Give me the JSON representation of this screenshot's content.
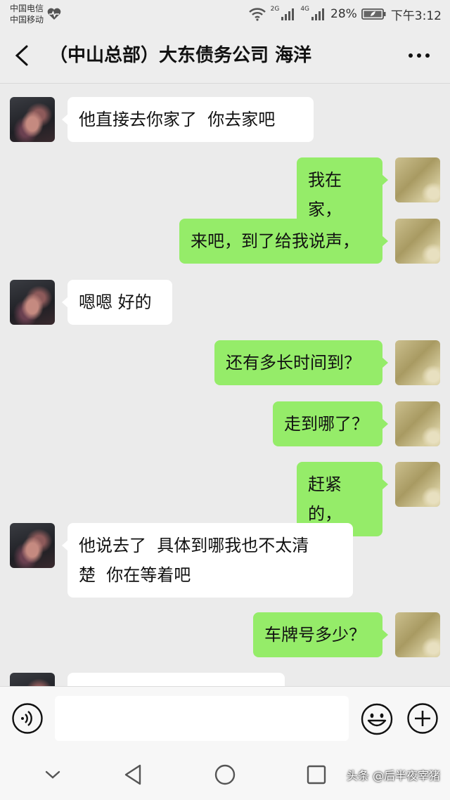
{
  "status_bar": {
    "carrier_1": "中国电信",
    "carrier_2": "中国移动",
    "net_1": "2G",
    "net_2": "4G",
    "battery": "28%",
    "time": "下午3:12"
  },
  "header": {
    "title": "（中山总部）大东债务公司  海洋"
  },
  "messages": [
    {
      "side": "in",
      "text": "他直接去你家了  你去家吧"
    },
    {
      "side": "out",
      "text": "我在家，"
    },
    {
      "side": "out",
      "text": "来吧，到了给我说声，"
    },
    {
      "side": "in",
      "text": "嗯嗯 好的"
    },
    {
      "side": "out",
      "text": "还有多长时间到？"
    },
    {
      "side": "out",
      "text": "走到哪了？"
    },
    {
      "side": "out",
      "text": "赶紧的，"
    },
    {
      "side": "in",
      "text": "他说去了  具体到哪我也不太清\n楚  你在等着吧"
    },
    {
      "side": "out",
      "text": "车牌号多少？"
    },
    {
      "side": "in",
      "text": ""
    }
  ],
  "input_bar": {
    "value": "",
    "icons": [
      "voice-icon",
      "emoji-icon",
      "plus-icon"
    ]
  },
  "nav_bar": {
    "icons": [
      "chevron-down-icon",
      "back-triangle-icon",
      "home-circle-icon",
      "recents-square-icon"
    ],
    "watermark": "头条 @后半夜宰猪"
  },
  "colors": {
    "outgoing_bubble": "#95ec69",
    "incoming_bubble": "#ffffff",
    "background": "#ebebeb"
  }
}
